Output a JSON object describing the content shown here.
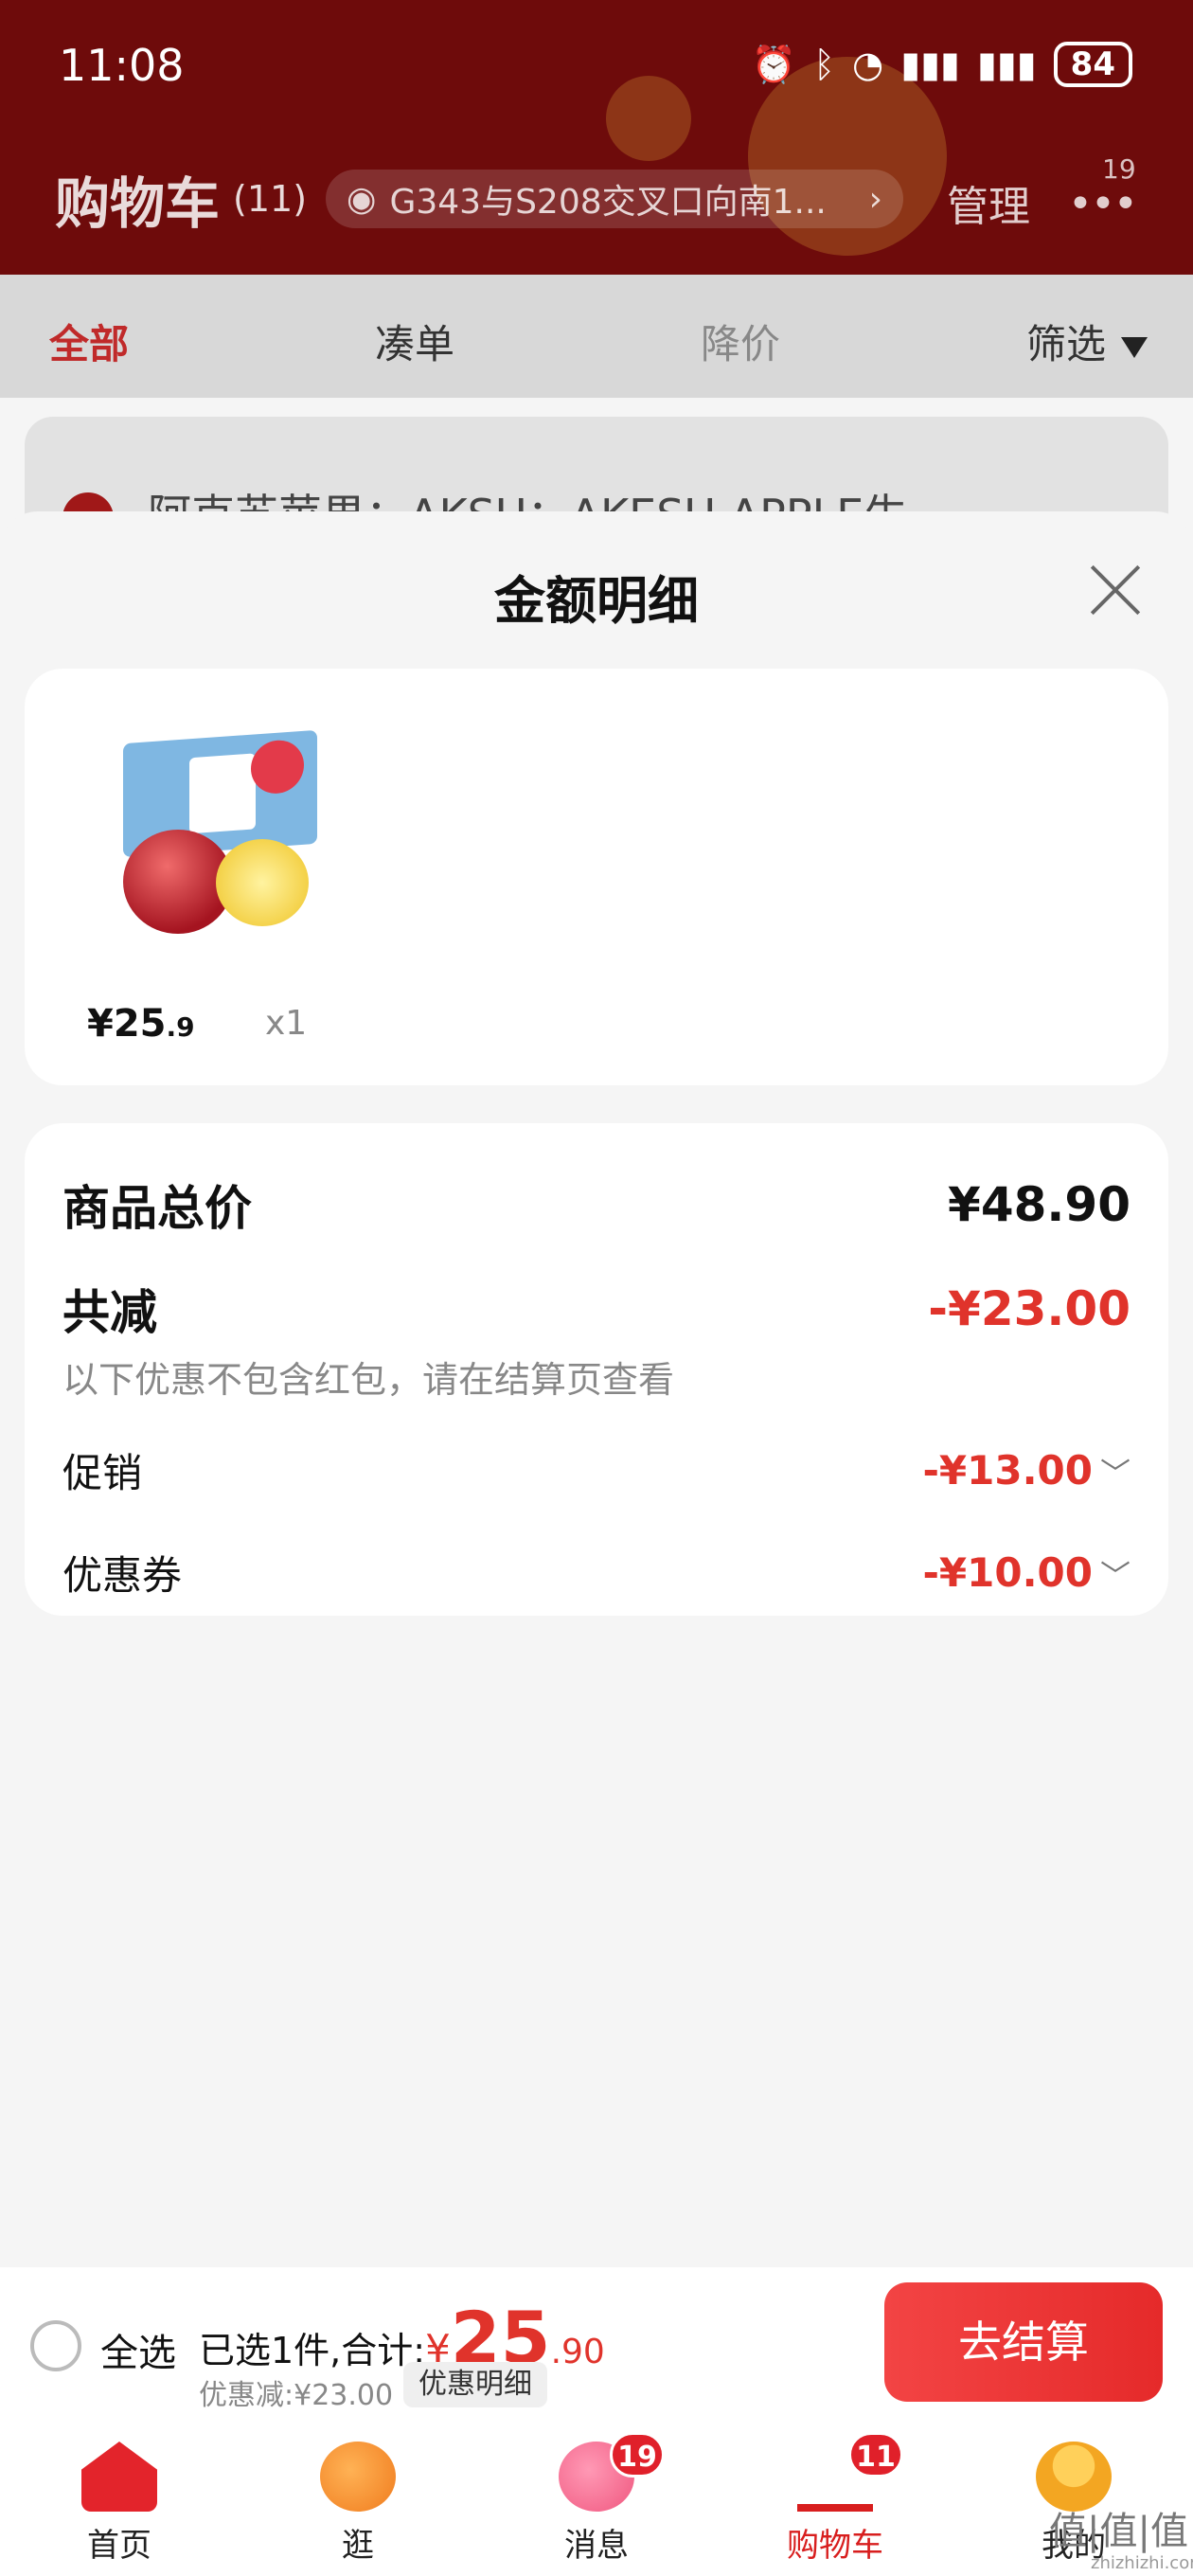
{
  "status_bar": {
    "time": "11:08",
    "battery": "84"
  },
  "header": {
    "title": "购物车",
    "count": "(11)",
    "location": "G343与S208交叉口向南1...",
    "manage": "管理",
    "more_badge": "19"
  },
  "tabs": [
    {
      "label": "全部",
      "active": true
    },
    {
      "label": "凑单"
    },
    {
      "label": "降价"
    },
    {
      "label": "筛选"
    }
  ],
  "store_peek": "阿克苏苹果：AKSU：AKESU APPLE生",
  "sheet": {
    "title": "金额明细",
    "product": {
      "price_main": "¥25",
      "price_dec": ".9",
      "qty": "x1"
    },
    "summary": {
      "total_label": "商品总价",
      "total_value": "¥48.90",
      "reduce_label": "共减",
      "reduce_value": "-¥23.00",
      "note": "以下优惠不包含红包，请在结算页查看",
      "promo_label": "促销",
      "promo_value": "-¥13.00",
      "coupon_label": "优惠券",
      "coupon_value": "-¥10.00"
    }
  },
  "checkout": {
    "select_all": "全选",
    "selected_text": "已选1件,合计:",
    "total_yen": "¥",
    "total_int": "25",
    "total_dec": ".90",
    "discount": "优惠减:¥23.00",
    "detail_button": "优惠明细",
    "pay_button": "去结算"
  },
  "tabbar": [
    {
      "label": "首页"
    },
    {
      "label": "逛"
    },
    {
      "label": "消息",
      "badge": "19"
    },
    {
      "label": "购物车",
      "badge": "11",
      "active": true
    },
    {
      "label": "我的"
    }
  ],
  "watermark": "值|值|值",
  "watermark_url": "zhizhizhi.com",
  "colors": {
    "header_bg": "#6e0b0b",
    "accent_red": "#e0332b",
    "pay_button": "#e52a2a"
  }
}
